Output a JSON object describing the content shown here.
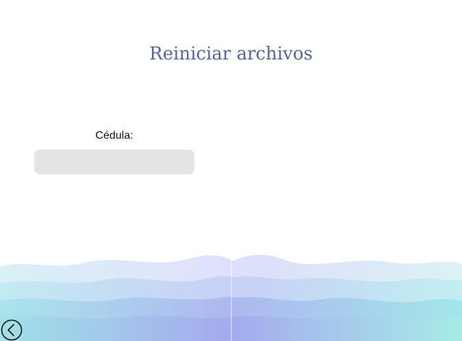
{
  "page": {
    "title": "Reiniciar archivos"
  },
  "form": {
    "cedula_label": "Cédula:",
    "cedula_value": ""
  },
  "navigation": {
    "back_icon": "chevron-left-circle-icon"
  },
  "colors": {
    "title": "#4e67a4",
    "input_background": "#e4e4e4",
    "wave_light": "#e2f4fb",
    "wave_mid": "#b7e6f0",
    "wave_accent": "#a8b4ef"
  }
}
